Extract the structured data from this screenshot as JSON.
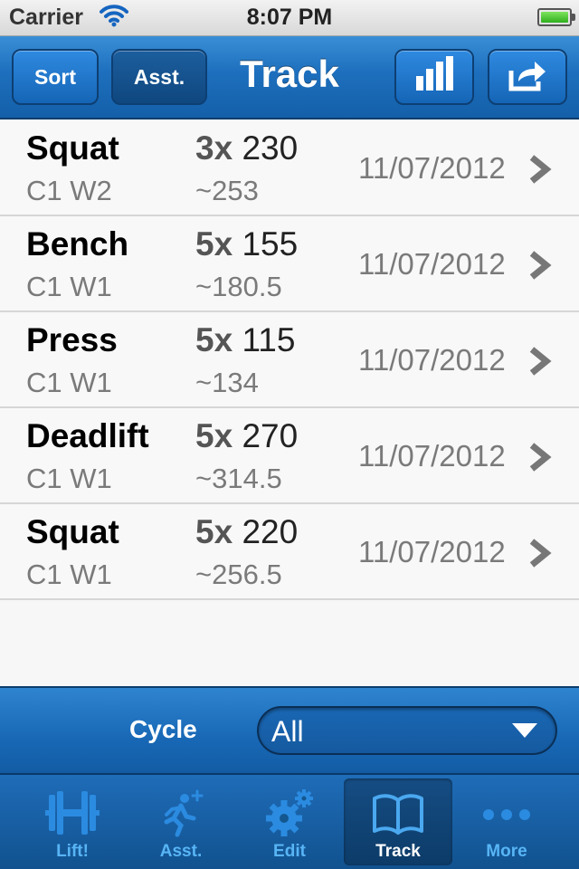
{
  "status": {
    "carrier": "Carrier",
    "time": "8:07 PM"
  },
  "navbar": {
    "title": "Track",
    "sort_label": "Sort",
    "asst_label": "Asst.",
    "chart_icon": "bar-chart-icon",
    "share_icon": "share-icon"
  },
  "entries": [
    {
      "lift": "Squat",
      "cycle_week": "C1 W2",
      "reps": "3x",
      "weight": "230",
      "estimate": "~253",
      "date": "11/07/2012"
    },
    {
      "lift": "Bench",
      "cycle_week": "C1 W1",
      "reps": "5x",
      "weight": "155",
      "estimate": "~180.5",
      "date": "11/07/2012"
    },
    {
      "lift": "Press",
      "cycle_week": "C1 W1",
      "reps": "5x",
      "weight": "115",
      "estimate": "~134",
      "date": "11/07/2012"
    },
    {
      "lift": "Deadlift",
      "cycle_week": "C1 W1",
      "reps": "5x",
      "weight": "270",
      "estimate": "~314.5",
      "date": "11/07/2012"
    },
    {
      "lift": "Squat",
      "cycle_week": "C1 W1",
      "reps": "5x",
      "weight": "220",
      "estimate": "~256.5",
      "date": "11/07/2012"
    }
  ],
  "filter": {
    "label": "Cycle",
    "value": "All"
  },
  "tabs": [
    {
      "label": "Lift!",
      "icon": "barbell-icon",
      "active": false
    },
    {
      "label": "Asst.",
      "icon": "runner-plus-icon",
      "active": false
    },
    {
      "label": "Edit",
      "icon": "gears-icon",
      "active": false
    },
    {
      "label": "Track",
      "icon": "open-book-icon",
      "active": true
    },
    {
      "label": "More",
      "icon": "more-dots-icon",
      "active": false
    }
  ],
  "colors": {
    "accent": "#1d6fbd",
    "tab_inactive": "#58b5f5",
    "tab_active": "#ffffff"
  }
}
